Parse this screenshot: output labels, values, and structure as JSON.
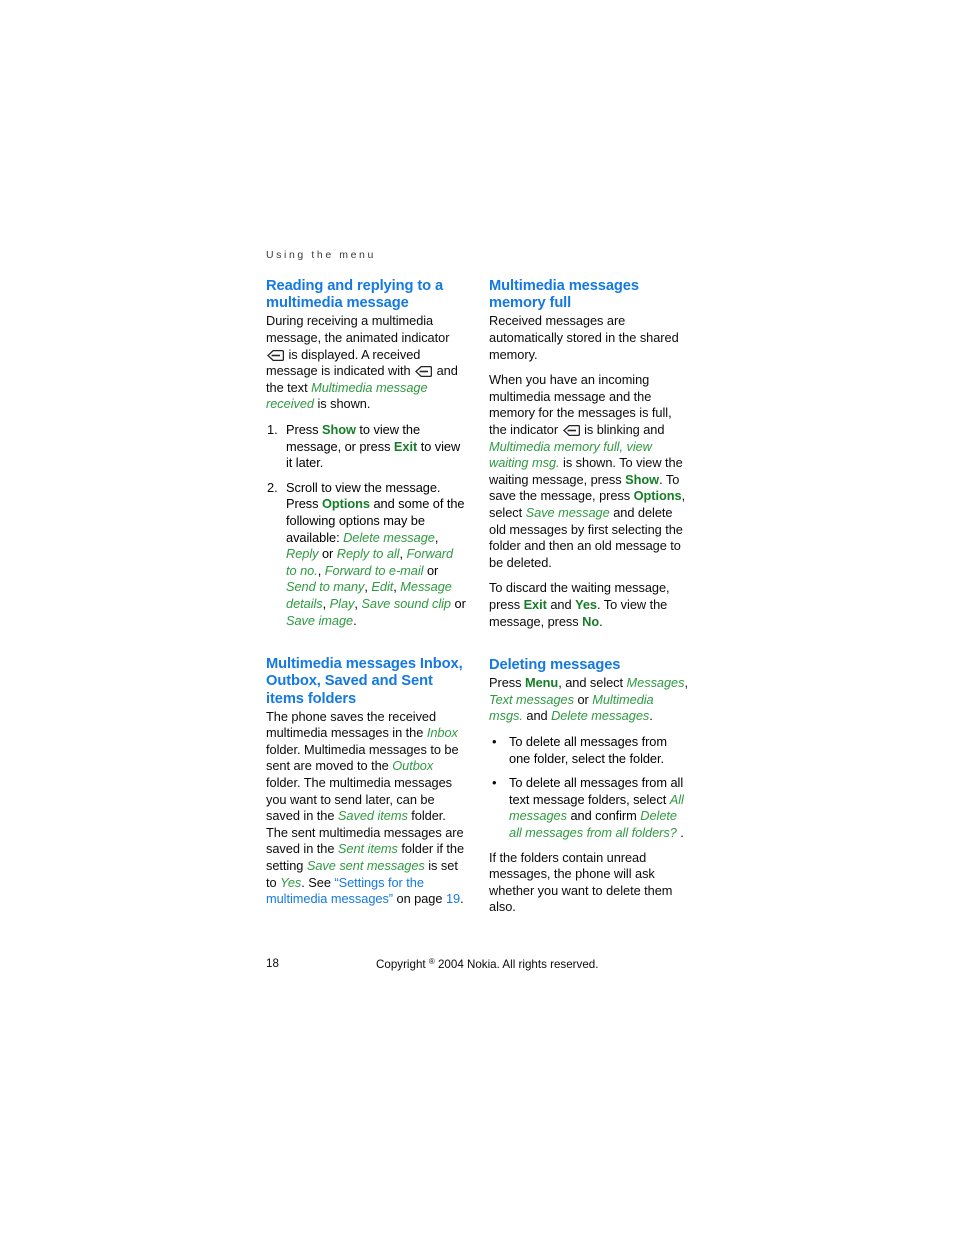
{
  "running_header": "Using the menu",
  "left_column": {
    "section1": {
      "heading": "Reading and replying to a multimedia message",
      "para1_a": "During receiving a multimedia message, the animated indicator ",
      "para1_b": " is displayed. A received message is indicated with ",
      "para1_c": " and the text ",
      "para1_italic": "Multimedia message received",
      "para1_d": " is shown.",
      "steps": [
        {
          "a": "Press ",
          "key1": "Show",
          "b": " to view the message, or press ",
          "key2": "Exit",
          "c": " to view it later."
        },
        {
          "a": "Scroll to view the message. Press ",
          "key1": "Options",
          "b": " and some of the following options may be available: ",
          "opt1": "Delete message",
          "sep1": ", ",
          "opt2": "Reply",
          "sep2": " or ",
          "opt3": "Reply to all",
          "sep3": ", ",
          "opt4": "Forward to no.",
          "sep4": ", ",
          "opt5": "Forward to e-mail",
          "sep5": " or ",
          "opt6": "Send to many",
          "sep6": ", ",
          "opt7": "Edit",
          "sep7": ", ",
          "opt8": "Message details",
          "sep8": ", ",
          "opt9": "Play",
          "sep9": ", ",
          "opt10": "Save sound clip",
          "sep10": " or ",
          "opt11": "Save image",
          "end": "."
        }
      ]
    },
    "section2": {
      "heading": "Multimedia messages Inbox, Outbox, Saved and Sent items folders",
      "p_a": "The phone saves the received multimedia messages in the ",
      "folder1": "Inbox",
      "p_b": " folder. Multimedia messages to be sent are moved to the ",
      "folder2": "Outbox",
      "p_c": " folder. The multimedia messages you want to send later, can be saved in the ",
      "folder3": "Saved items",
      "p_d": " folder. The sent multimedia messages are saved in the ",
      "folder4": "Sent items",
      "p_e": " folder if the setting ",
      "setting": "Save sent messages",
      "p_f": " is set to ",
      "value": "Yes",
      "p_g": ". See ",
      "xref": "“Settings for the multimedia messages”",
      "p_h": " on page ",
      "xref_page": "19",
      "p_i": "."
    }
  },
  "right_column": {
    "section1": {
      "heading": "Multimedia messages memory full",
      "para1": "Received messages are automatically stored in the shared memory.",
      "para2_a": "When you have an incoming multimedia message and the memory for the messages is full, the indicator ",
      "para2_b": " is blinking and ",
      "para2_italic": "Multimedia memory full, view waiting msg.",
      "para2_c": " is shown. To view the waiting message, press ",
      "key1": "Show",
      "para2_d": ". To save the message, press ",
      "key2": "Options",
      "para2_e": ", select ",
      "opt1": "Save message",
      "para2_f": " and delete old messages by first selecting the folder and then an old message to be deleted.",
      "para3_a": "To discard the waiting message, press ",
      "key3": "Exit",
      "para3_b": " and ",
      "key4": "Yes",
      "para3_c": ". To view the message, press ",
      "key5": "No",
      "para3_d": "."
    },
    "section2": {
      "heading": "Deleting messages",
      "p_a": "Press ",
      "key_menu": "Menu",
      "p_b": ", and select ",
      "m1": "Messages",
      "p_c": ", ",
      "m2": "Text messages",
      "p_d": " or ",
      "m3": "Multimedia msgs.",
      "p_e": " and ",
      "m4": "Delete messages",
      "p_f": ".",
      "bullet1": "To delete all messages from one folder, select the folder.",
      "bullet2_a": "To delete all messages from all text message folders, select ",
      "bullet2_m1": "All messages",
      "bullet2_b": " and confirm ",
      "bullet2_m2": "Delete all messages from all folders?",
      "bullet2_c": " .",
      "closing": "If the folders contain unread messages, the phone will ask whether you want to delete them also."
    }
  },
  "footer": {
    "page_number": "18",
    "copyright_pre": "Copyright ",
    "copyright_symbol": "®",
    "copyright_post": " 2004 Nokia. All rights reserved."
  },
  "colors": {
    "heading_blue": "#1479e0",
    "key_green": "#167d27",
    "menu_green": "#2f9a41",
    "body_black": "#0b0b0b",
    "header_gray": "#3a3a3a"
  }
}
